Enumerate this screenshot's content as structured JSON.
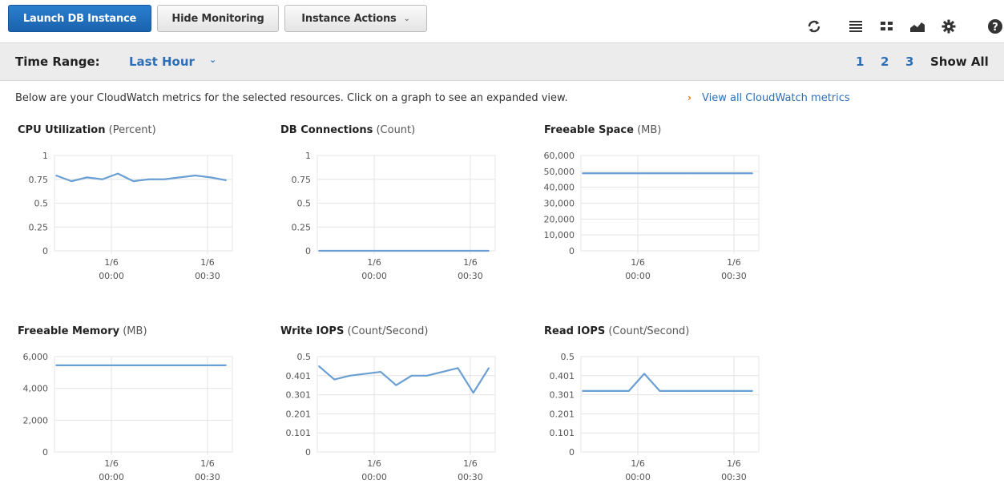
{
  "toolbar": {
    "launch_label": "Launch DB Instance",
    "hide_label": "Hide Monitoring",
    "actions_label": "Instance Actions",
    "icons": [
      "refresh-icon",
      "list-view-icon",
      "grid-view-icon",
      "chart-view-icon",
      "gear-icon",
      "help-icon"
    ]
  },
  "range": {
    "label": "Time Range:",
    "value": "Last Hour",
    "pages": [
      "1",
      "2",
      "3"
    ],
    "show_all": "Show All"
  },
  "info": {
    "text": "Below are your CloudWatch metrics for the selected resources. Click on a graph to see an expanded view.",
    "link": "View all CloudWatch metrics"
  },
  "colors": {
    "primary": "#1b62ad",
    "link": "#2d6fb6",
    "series": "#6a9fd4",
    "arrow": "#e07b00"
  },
  "chart_data": [
    {
      "type": "line",
      "title": "CPU Utilization",
      "unit": "(Percent)",
      "yticks": [
        "1",
        "0.75",
        "0.5",
        "0.25",
        "0"
      ],
      "ylim": [
        0,
        1
      ],
      "xticks": [
        {
          "top": "1/6",
          "bottom": "00:00"
        },
        {
          "top": "1/6",
          "bottom": "00:30"
        }
      ],
      "values": [
        0.79,
        0.73,
        0.77,
        0.75,
        0.81,
        0.73,
        0.75,
        0.75,
        0.77,
        0.79,
        0.77,
        0.74
      ]
    },
    {
      "type": "line",
      "title": "DB Connections",
      "unit": "(Count)",
      "yticks": [
        "1",
        "0.75",
        "0.5",
        "0.25",
        "0"
      ],
      "ylim": [
        0,
        1
      ],
      "xticks": [
        {
          "top": "1/6",
          "bottom": "00:00"
        },
        {
          "top": "1/6",
          "bottom": "00:30"
        }
      ],
      "values": [
        0,
        0,
        0,
        0,
        0,
        0,
        0,
        0,
        0,
        0,
        0,
        0
      ]
    },
    {
      "type": "line",
      "title": "Freeable Space",
      "unit": "(MB)",
      "yticks": [
        "60,000",
        "50,000",
        "40,000",
        "30,000",
        "20,000",
        "10,000",
        "0"
      ],
      "ylim": [
        0,
        60000
      ],
      "xticks": [
        {
          "top": "1/6",
          "bottom": "00:00"
        },
        {
          "top": "1/6",
          "bottom": "00:30"
        }
      ],
      "values": [
        48800,
        48800,
        48800,
        48800,
        48800,
        48800,
        48800,
        48800,
        48800,
        48800,
        48800,
        48800
      ]
    },
    {
      "type": "line",
      "title": "Freeable Memory",
      "unit": "(MB)",
      "yticks": [
        "6,000",
        "4,000",
        "2,000",
        "0"
      ],
      "ylim": [
        0,
        6000
      ],
      "xticks": [
        {
          "top": "1/6",
          "bottom": "00:00"
        },
        {
          "top": "1/6",
          "bottom": "00:30"
        }
      ],
      "values": [
        5450,
        5450,
        5450,
        5450,
        5450,
        5450,
        5450,
        5450,
        5450,
        5450,
        5450,
        5450
      ]
    },
    {
      "type": "line",
      "title": "Write IOPS",
      "unit": "(Count/Second)",
      "yticks": [
        "0.5",
        "0.401",
        "0.301",
        "0.201",
        "0.101",
        "0"
      ],
      "ylim": [
        0,
        0.5
      ],
      "xticks": [
        {
          "top": "1/6",
          "bottom": "00:00"
        },
        {
          "top": "1/6",
          "bottom": "00:30"
        }
      ],
      "values": [
        0.45,
        0.38,
        0.4,
        0.41,
        0.42,
        0.35,
        0.4,
        0.4,
        0.42,
        0.44,
        0.31,
        0.44
      ]
    },
    {
      "type": "line",
      "title": "Read IOPS",
      "unit": "(Count/Second)",
      "yticks": [
        "0.5",
        "0.401",
        "0.301",
        "0.201",
        "0.101",
        "0"
      ],
      "ylim": [
        0,
        0.5
      ],
      "xticks": [
        {
          "top": "1/6",
          "bottom": "00:00"
        },
        {
          "top": "1/6",
          "bottom": "00:30"
        }
      ],
      "values": [
        0.32,
        0.32,
        0.32,
        0.32,
        0.41,
        0.32,
        0.32,
        0.32,
        0.32,
        0.32,
        0.32,
        0.32
      ]
    }
  ]
}
